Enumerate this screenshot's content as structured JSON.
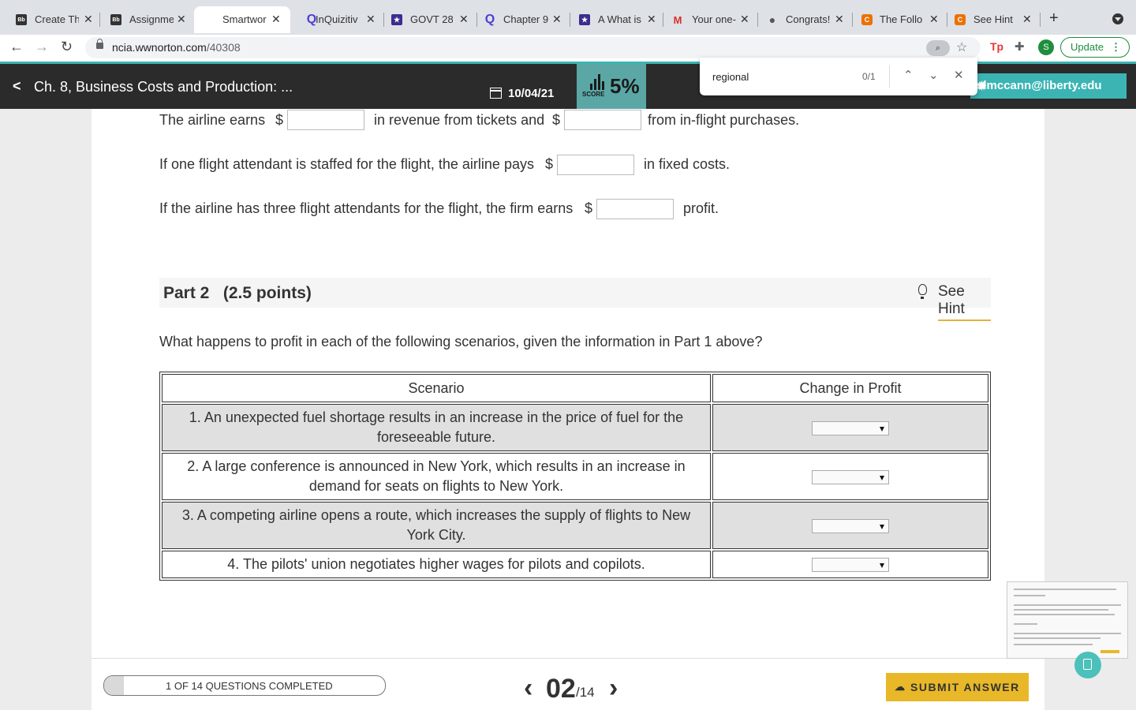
{
  "browser": {
    "tabs": [
      {
        "title": "Create Th",
        "favicon": "Bb"
      },
      {
        "title": "Assignme",
        "favicon": "Bb"
      },
      {
        "title": "Smartwor",
        "favicon": ""
      },
      {
        "title": "InQuizitiv",
        "favicon": "Q"
      },
      {
        "title": "GOVT 28",
        "favicon": "★"
      },
      {
        "title": "Chapter 9",
        "favicon": "Q"
      },
      {
        "title": "A What is",
        "favicon": "★"
      },
      {
        "title": "Your one-",
        "favicon": "M"
      },
      {
        "title": "Congrats!",
        "favicon": "●"
      },
      {
        "title": "The Follo",
        "favicon": "C"
      },
      {
        "title": "See Hint",
        "favicon": "C"
      }
    ],
    "new_tab": "+",
    "url_host": "ncia.wwnorton.com",
    "url_path": "/40308",
    "extension_tp": "Tp",
    "profile_initial": "S",
    "update_label": "Update",
    "find": {
      "query": "regional",
      "count": "0/1"
    }
  },
  "app": {
    "title": "Ch. 8, Business Costs and Production: ...",
    "date": "10/04/21",
    "score_label": "SCORE",
    "score_value": "5%",
    "user_email": "slmccann@liberty.edu"
  },
  "part1": {
    "line1_a": "The airline earns",
    "line1_b": "in revenue from tickets and",
    "line1_c": "from in-flight purchases.",
    "line2_a": "If one flight attendant is staffed for the flight, the airline pays",
    "line2_b": "in fixed costs.",
    "line3_a": "If the airline has three flight attendants for the flight, the firm earns",
    "line3_b": "profit.",
    "currency": "$"
  },
  "part2": {
    "heading": "Part 2   (2.5 points)",
    "hint_label": "See Hint",
    "question": "What happens to profit in each of the following scenarios, given the information in Part 1 above?",
    "columns": [
      "Scenario",
      "Change in Profit"
    ],
    "rows": [
      {
        "scenario": "1. An unexpected fuel shortage results in an increase in the price of fuel for the foreseeable future.",
        "selected": ""
      },
      {
        "scenario": "2. A large conference is announced in New York, which results in an increase in demand for seats on flights to New York.",
        "selected": ""
      },
      {
        "scenario": "3. A competing airline opens a route, which increases the supply of flights to New York City.",
        "selected": ""
      },
      {
        "scenario": "4. The pilots' union negotiates higher wages for pilots and copilots.",
        "selected": ""
      }
    ]
  },
  "footer": {
    "progress_label": "1 OF 14 QUESTIONS COMPLETED",
    "progress_fraction": 0.0714,
    "current_page": "02",
    "total_pages": "/14",
    "submit_label": "SUBMIT ANSWER"
  }
}
